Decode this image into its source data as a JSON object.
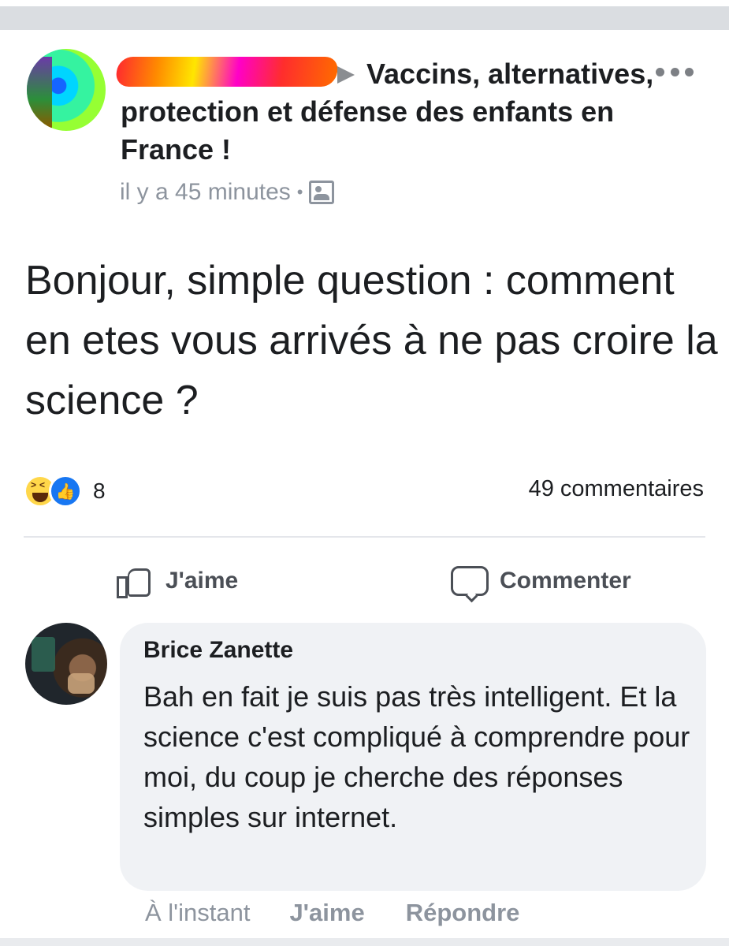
{
  "post": {
    "group_title": "Vaccins, alternatives, protection et défense des enfants en France !",
    "timestamp": "il y a 45 minutes",
    "separator": "•",
    "audience_icon": "group-icon",
    "body": "Bonjour, simple question : comment en etes vous arrivés à ne pas croire la science ?",
    "reaction_count": "8",
    "reactions": [
      "haha-icon",
      "like-icon"
    ],
    "comments_count": "49 commentaires"
  },
  "actions": {
    "like_label": "J'aime",
    "comment_label": "Commenter"
  },
  "comment": {
    "author": "Brice Zanette",
    "text": "Bah en fait je suis pas très intelligent. Et la science c'est compliqué à comprendre pour moi, du coup je cherche des réponses simples sur internet.",
    "time": "À l'instant",
    "like_label": "J'aime",
    "reply_label": "Répondre"
  },
  "colors": {
    "link_blue": "#1877f2",
    "secondary_text": "#8d949e",
    "bubble_bg": "#f0f2f5"
  }
}
